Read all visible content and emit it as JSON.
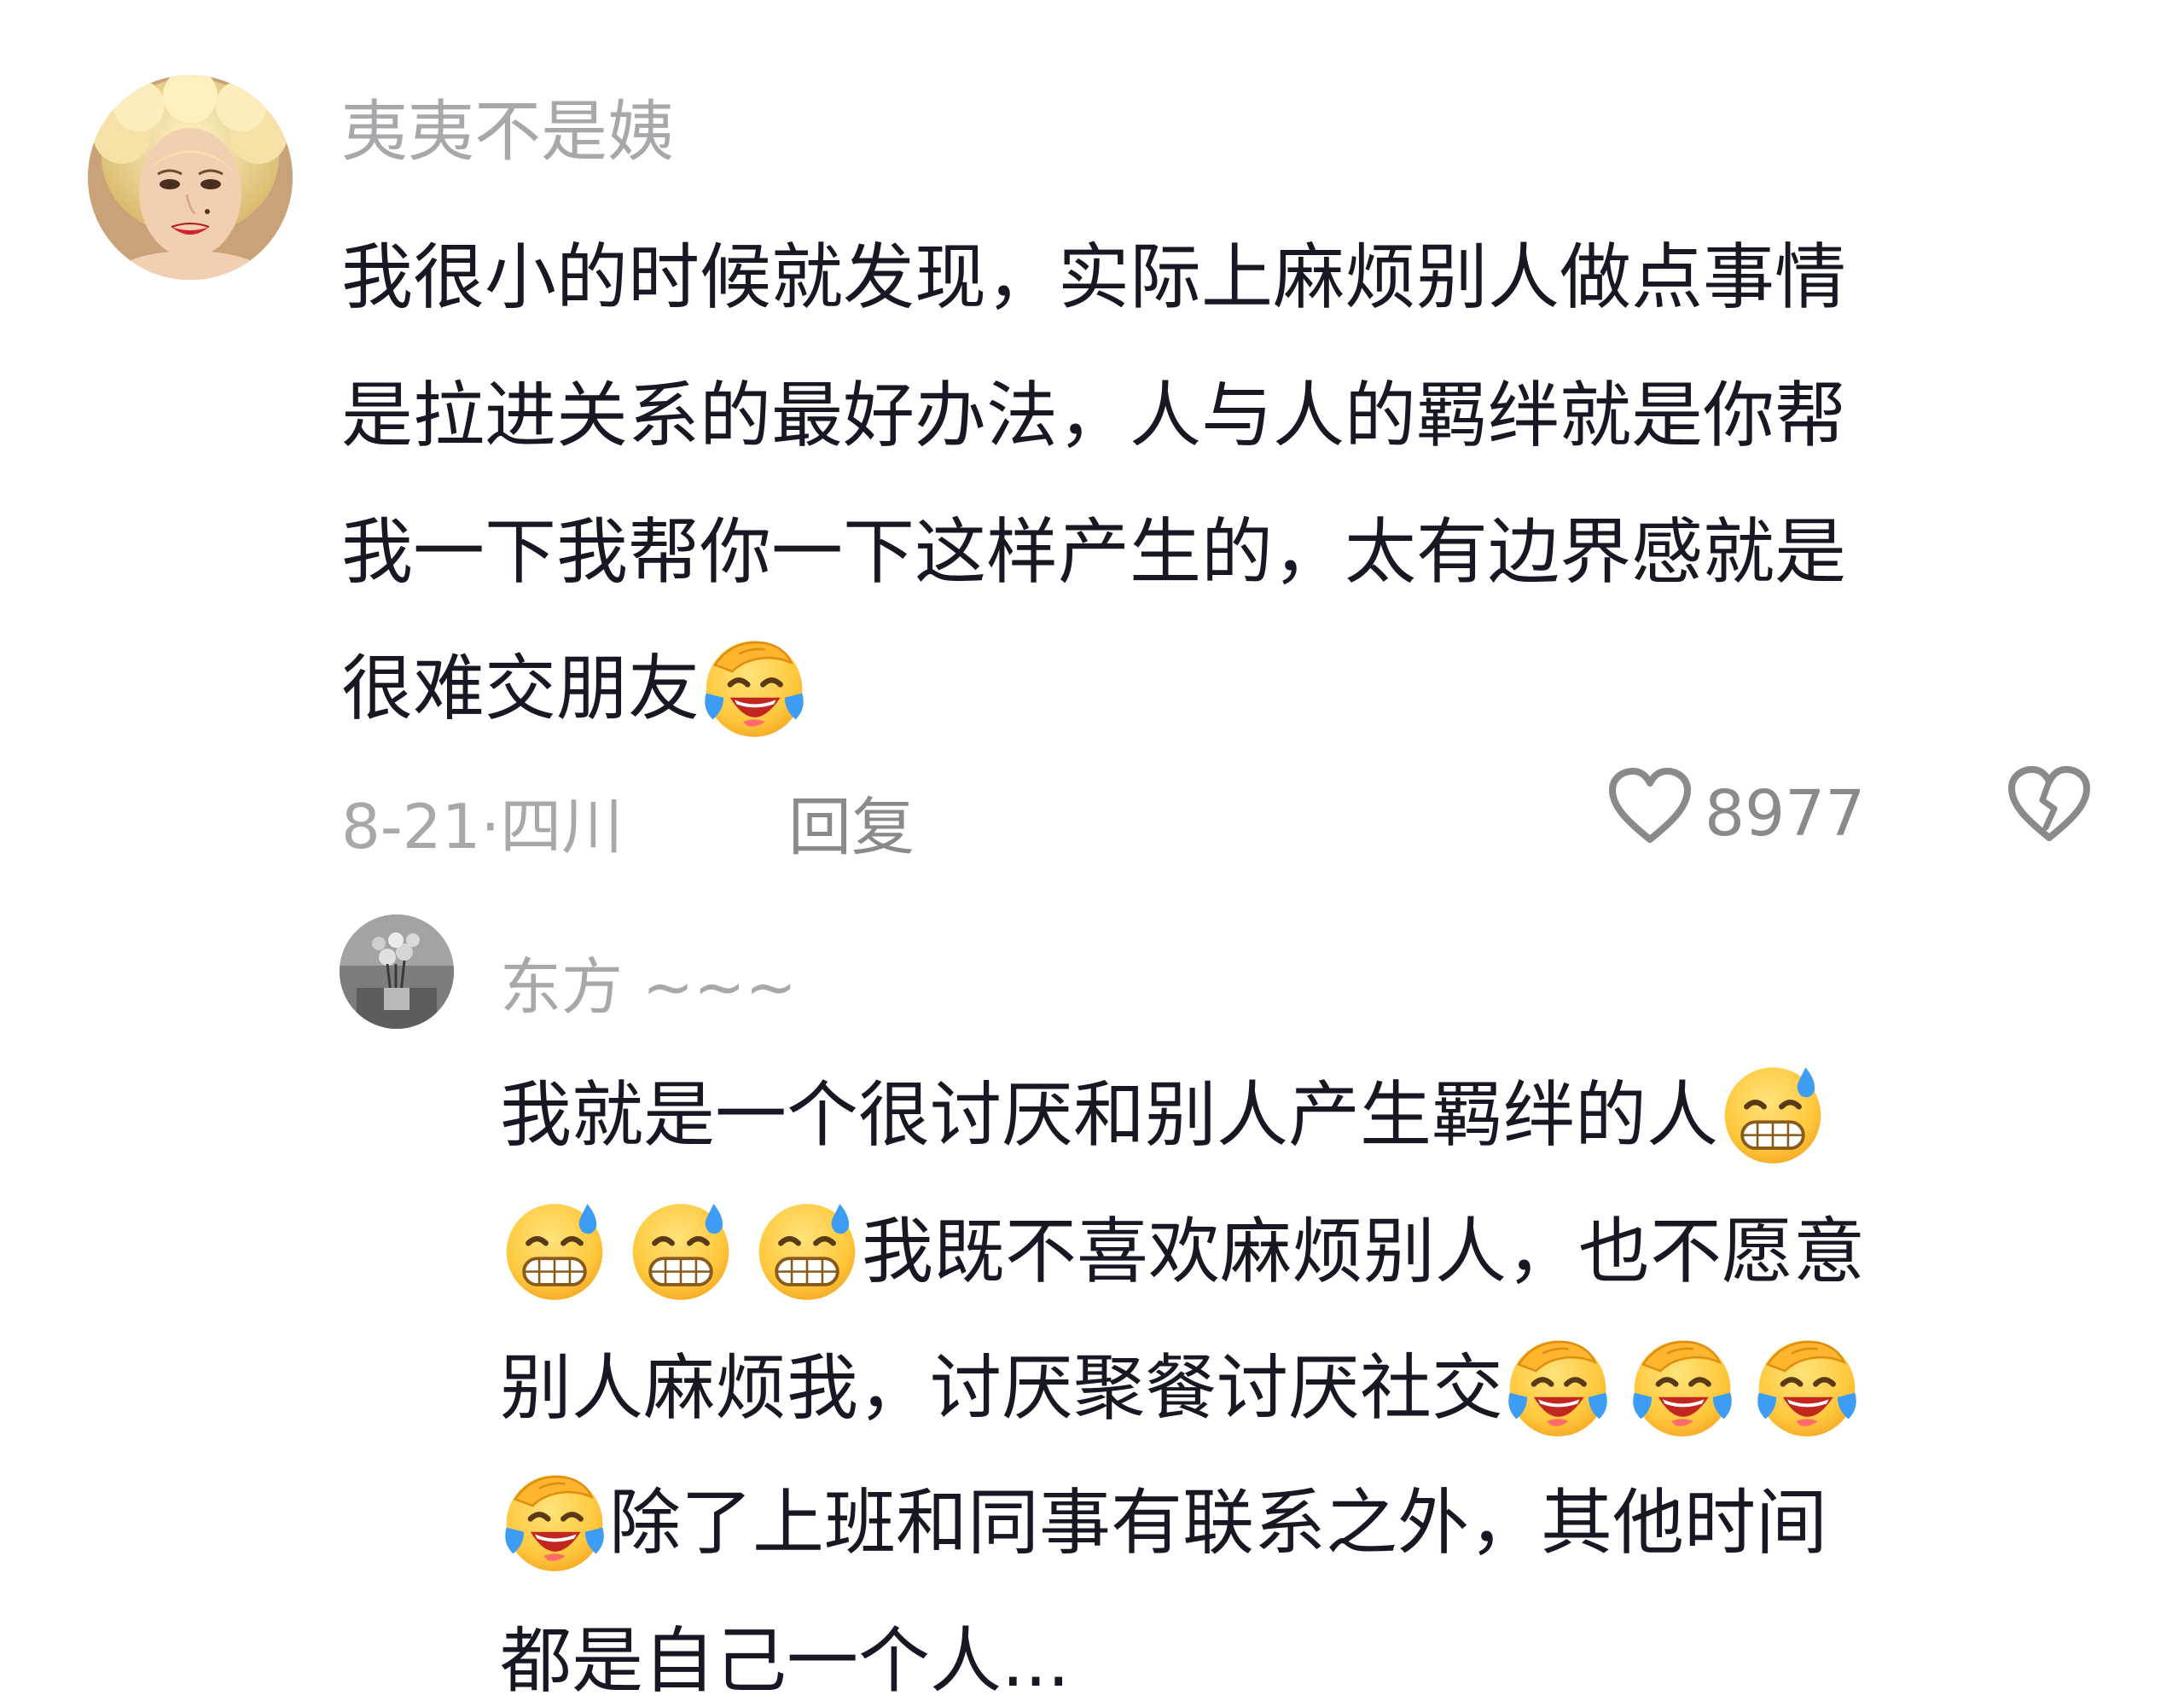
{
  "comment": {
    "username": "夷夷不是姨",
    "lines": [
      "我很小的时候就发现，实际上麻烦别人做点事情",
      "是拉进关系的最好办法，人与人的羁绊就是你帮",
      "我一下我帮你一下这样产生的，太有边界感就是",
      "很难交朋友"
    ],
    "date": "8-21",
    "separator": "·",
    "location": "四川",
    "reply_label": "回复",
    "like_count": "8977",
    "icons": {
      "like": "heart-outline-icon",
      "dislike": "broken-heart-icon",
      "emoji_laugh": "tears-of-joy-emoji",
      "emoji_sweat": "grin-sweat-emoji"
    }
  },
  "reply": {
    "username": "东方 ~~~",
    "lines": [
      "我就是一个很讨厌和别人产生羁绊的人",
      "我既不喜欢麻烦别人，也不愿意",
      "别人麻烦我，讨厌聚餐讨厌社交",
      "除了上班和同事有联系之外，其他时间",
      "都是自己一个人..."
    ]
  },
  "colors": {
    "text_primary": "#161823",
    "text_secondary": "#a8a8ac",
    "icon_gray": "#8a8a8e",
    "emoji_yellow": "#ffc83d",
    "emoji_blue": "#3d9df5"
  }
}
